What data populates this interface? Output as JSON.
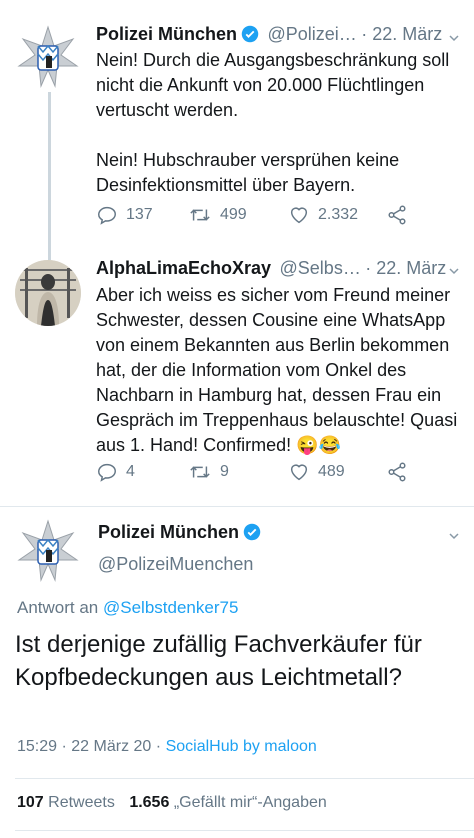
{
  "tweet1": {
    "name": "Polizei München",
    "handle": "@Polizei…",
    "date": "22. März",
    "text": "Nein! Durch die Ausgangsbeschränkung soll nicht die Ankunft von 20.000 Flüchtlingen vertuscht werden.\n\nNein! Hubschrauber versprühen keine Desinfektionsmittel über Bayern.",
    "replies": "137",
    "retweets": "499",
    "likes": "2.332"
  },
  "tweet2": {
    "name": "AlphaLimaEchoXray",
    "handle": "@Selbs…",
    "date": "22. März",
    "text": "Aber ich weiss es sicher vom Freund meiner Schwester, dessen Cousine eine WhatsApp von einem Bekannten aus Berlin bekommen hat, der die Information vom Onkel des Nachbarn in Hamburg hat, dessen Frau ein Gespräch im Treppenhaus belauschte! Quasi aus 1. Hand! Confirmed! 😜😂",
    "replies": "4",
    "retweets": "9",
    "likes": "489"
  },
  "main_tweet": {
    "name": "Polizei München",
    "handle": "@PolizeiMuenchen",
    "reply_prefix": "Antwort an",
    "reply_to": "@Selbstdenker75",
    "text": "Ist derjenige zufällig Fachverkäufer für Kopfbedeckungen aus Leichtmetall?",
    "time": "15:29",
    "date": "22 März 20",
    "separator": "·",
    "source": "SocialHub by maloon",
    "retweet_count": "107",
    "retweet_label": "Retweets",
    "like_count": "1.656",
    "like_label": "„Gefällt mir“-Angaben"
  },
  "colors": {
    "link": "#1da1f2",
    "verified": "#1da1f2",
    "muted": "#657786"
  },
  "icons": [
    "police-star-icon",
    "verified-icon",
    "chevron-down-icon",
    "reply-icon",
    "retweet-icon",
    "like-icon",
    "share-icon"
  ]
}
